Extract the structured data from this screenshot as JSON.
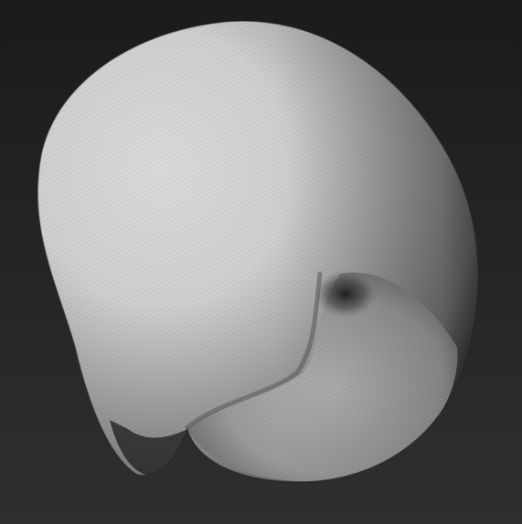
{
  "viewport": {
    "background_top": "#1b1b1b",
    "background_bottom": "#2f2f2f",
    "material_highlight": "#dadada",
    "material_mid": "#9a9a9a",
    "material_shadow": "#2a2a2a",
    "object_icon": "sculpt-mesh-icon"
  }
}
